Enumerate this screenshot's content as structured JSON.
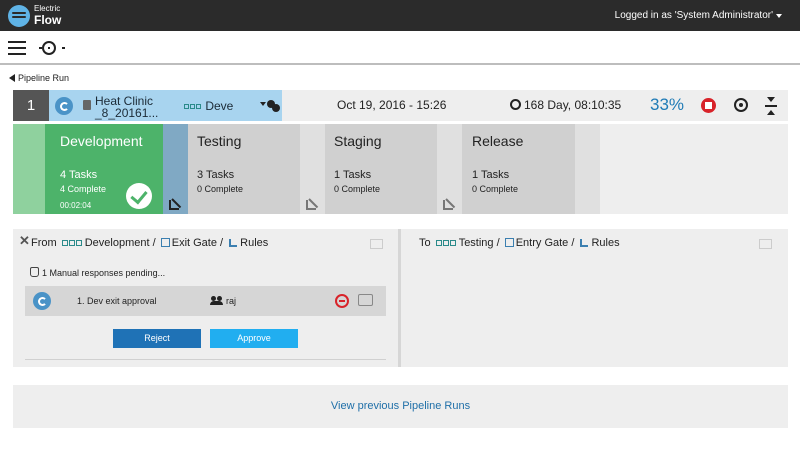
{
  "app": {
    "brand_line1": "Electric",
    "brand_line2": "Flow"
  },
  "header": {
    "user_label": "Logged in as 'System Administrator'"
  },
  "nav": {
    "back_label": "Pipeline Run"
  },
  "run": {
    "number": "1",
    "name_line1": "Heat Clinic",
    "name_line2": "_8_20161...",
    "current_stage": "Deve",
    "date": "Oct 19, 2016 - 15:26",
    "duration": "168 Day, 08:10:35",
    "progress": "33%"
  },
  "stages": [
    {
      "name": "Development",
      "tasks": "4 Tasks",
      "complete": "4 Complete",
      "elapsed": "00:02:04",
      "status": "completed"
    },
    {
      "name": "Testing",
      "tasks": "3 Tasks",
      "complete": "0 Complete",
      "status": "pending"
    },
    {
      "name": "Staging",
      "tasks": "1 Tasks",
      "complete": "0 Complete",
      "status": "pending"
    },
    {
      "name": "Release",
      "tasks": "1 Tasks",
      "complete": "0 Complete",
      "status": "pending"
    }
  ],
  "left_panel": {
    "from_label": "From",
    "stage": "Development /",
    "gate": "Exit Gate /",
    "rules": "Rules",
    "pending": "1 Manual responses pending...",
    "task_label": "1.   Dev exit approval",
    "assignee": "raj",
    "reject_label": "Reject",
    "approve_label": "Approve"
  },
  "right_panel": {
    "to_label": "To",
    "stage": "Testing /",
    "gate": "Entry Gate /",
    "rules": "Rules"
  },
  "footer": {
    "link_label": "View previous Pipeline Runs"
  },
  "colors": {
    "topbar": "#2b2b2b",
    "completed_stage": "#4db36a",
    "active_run": "#a8d4ef",
    "progress_text": "#1f7bb6",
    "abort": "#d8232a",
    "reject": "#1f72b6",
    "approve": "#21aef0"
  }
}
